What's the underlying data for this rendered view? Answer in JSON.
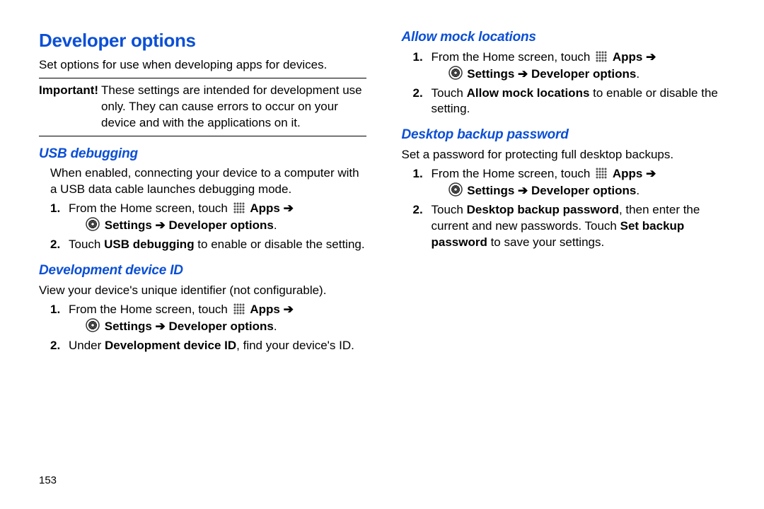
{
  "mainTitle": "Developer options",
  "intro": "Set options for use when developing apps for devices.",
  "importantLabel": "Important!",
  "importantText": "These settings are intended for development use only. They can cause errors to occur on your device and with the applications on it.",
  "nav": {
    "fromHome": "From the Home screen, touch ",
    "apps": "Apps",
    "arrow": "➔",
    "settings": "Settings",
    "devOptions": "Developer options",
    "period": "."
  },
  "left": {
    "usb": {
      "title": "USB debugging",
      "desc": "When enabled, connecting your device to a computer with a USB data cable launches debugging mode.",
      "step2a": "Touch ",
      "step2bold": "USB debugging",
      "step2b": " to enable or disable the setting."
    },
    "devId": {
      "title": "Development device ID",
      "desc": "View your device's unique identifier (not configurable).",
      "step2a": "Under ",
      "step2bold": "Development device ID",
      "step2b": ", find your device's ID."
    }
  },
  "right": {
    "mock": {
      "title": "Allow mock locations",
      "step2a": "Touch ",
      "step2bold": "Allow mock locations",
      "step2b": " to enable or disable the setting."
    },
    "backup": {
      "title": "Desktop backup password",
      "desc": "Set a password for protecting full desktop backups.",
      "step2a": "Touch ",
      "step2bold1": "Desktop backup password",
      "step2mid": ", then enter the current and new passwords. Touch ",
      "step2bold2": "Set backup password",
      "step2end": " to save your settings."
    }
  },
  "pageNumber": "153"
}
